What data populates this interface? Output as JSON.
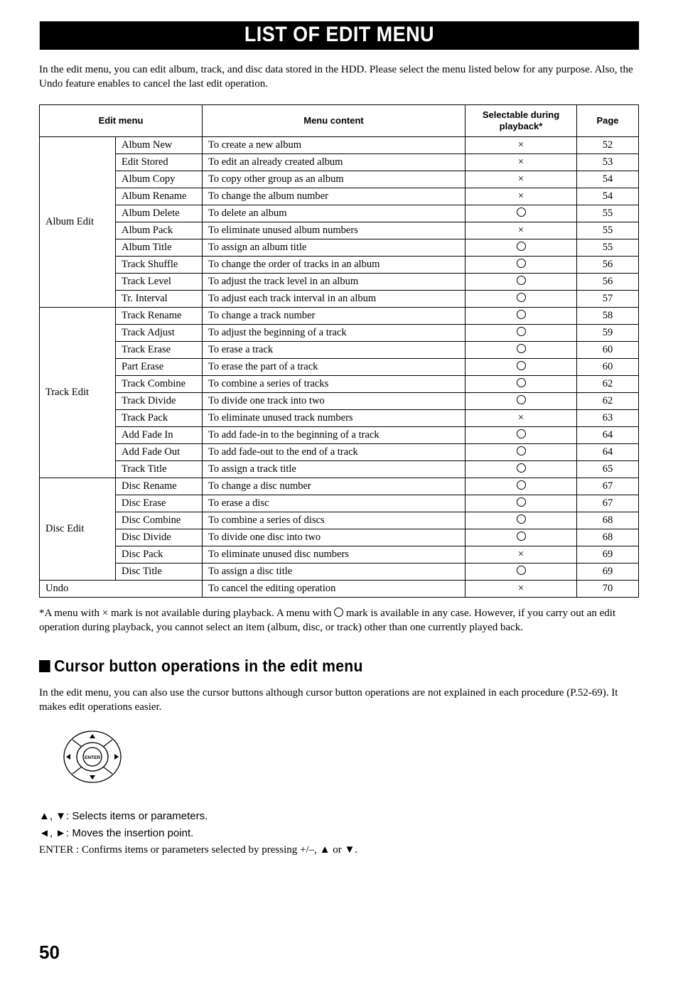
{
  "title": "LIST OF EDIT MENU",
  "intro": "In the edit menu, you can edit album, track, and disc data stored in the HDD. Please select the menu listed below for any purpose. Also, the Undo feature enables to cancel the last edit operation.",
  "headers": {
    "col1": "Edit menu",
    "col2": "Menu content",
    "col3": "Selectable during playback*",
    "col4": "Page"
  },
  "groups": [
    {
      "name": "Album Edit",
      "rows": [
        {
          "item": "Album New",
          "desc": "To create a new album",
          "sel": "×",
          "page": "52"
        },
        {
          "item": "Edit Stored",
          "desc": "To edit an already created album",
          "sel": "×",
          "page": "53"
        },
        {
          "item": "Album Copy",
          "desc": "To copy other group as an album",
          "sel": "×",
          "page": "54"
        },
        {
          "item": "Album Rename",
          "desc": "To change the album number",
          "sel": "×",
          "page": "54"
        },
        {
          "item": "Album Delete",
          "desc": "To delete an album",
          "sel": "○",
          "page": "55"
        },
        {
          "item": "Album Pack",
          "desc": "To eliminate unused album numbers",
          "sel": "×",
          "page": "55"
        },
        {
          "item": "Album Title",
          "desc": "To assign an album title",
          "sel": "○",
          "page": "55"
        },
        {
          "item": "Track Shuffle",
          "desc": "To change the order of tracks in an album",
          "sel": "○",
          "page": "56"
        },
        {
          "item": "Track Level",
          "desc": "To adjust the track level in an album",
          "sel": "○",
          "page": "56"
        },
        {
          "item": "Tr. Interval",
          "desc": "To adjust each track interval in an album",
          "sel": "○",
          "page": "57"
        }
      ]
    },
    {
      "name": "Track Edit",
      "rows": [
        {
          "item": "Track Rename",
          "desc": "To change a track number",
          "sel": "○",
          "page": "58"
        },
        {
          "item": "Track Adjust",
          "desc": "To adjust the beginning of a track",
          "sel": "○",
          "page": "59"
        },
        {
          "item": "Track Erase",
          "desc": "To erase a track",
          "sel": "○",
          "page": "60"
        },
        {
          "item": "Part Erase",
          "desc": "To erase the part of a track",
          "sel": "○",
          "page": "60"
        },
        {
          "item": "Track Combine",
          "desc": "To combine a series of tracks",
          "sel": "○",
          "page": "62"
        },
        {
          "item": "Track Divide",
          "desc": "To divide one track into two",
          "sel": "○",
          "page": "62"
        },
        {
          "item": "Track Pack",
          "desc": "To eliminate unused track numbers",
          "sel": "×",
          "page": "63"
        },
        {
          "item": "Add Fade In",
          "desc": "To add fade-in to the beginning of a track",
          "sel": "○",
          "page": "64"
        },
        {
          "item": "Add Fade Out",
          "desc": "To add fade-out to the end of a track",
          "sel": "○",
          "page": "64"
        },
        {
          "item": "Track Title",
          "desc": "To assign a track title",
          "sel": "○",
          "page": "65"
        }
      ]
    },
    {
      "name": "Disc Edit",
      "rows": [
        {
          "item": "Disc Rename",
          "desc": "To change a disc number",
          "sel": "○",
          "page": "67"
        },
        {
          "item": "Disc Erase",
          "desc": "To erase a disc",
          "sel": "○",
          "page": "67"
        },
        {
          "item": "Disc Combine",
          "desc": "To combine a series of discs",
          "sel": "○",
          "page": "68"
        },
        {
          "item": "Disc Divide",
          "desc": "To divide one disc into two",
          "sel": "○",
          "page": "68"
        },
        {
          "item": "Disc Pack",
          "desc": "To eliminate unused disc numbers",
          "sel": "×",
          "page": "69"
        },
        {
          "item": "Disc Title",
          "desc": "To assign a disc title",
          "sel": "○",
          "page": "69"
        }
      ]
    }
  ],
  "undo": {
    "name": "Undo",
    "desc": "To cancel the editing operation",
    "sel": "×",
    "page": "70"
  },
  "footnote_pre": "*A menu with ",
  "footnote_x": "×",
  "footnote_mid1": " mark is not available during playback. A menu with ",
  "footnote_mid2": " mark is available in any case. However, if you carry out an edit operation during playback, you cannot select an item (album, disc, or track) other than one currently played back.",
  "subhead": "Cursor button operations in the edit menu",
  "subpara": "In the edit menu, you can also use the cursor buttons although cursor button operations are not explained in each procedure (P.52-69). It makes edit operations easier.",
  "bullets": {
    "b1": "▲, ▼: Selects items or parameters.",
    "b2": "◄, ►: Moves the insertion point.",
    "b3": "ENTER : Confirms items or parameters selected by pressing +/–, ▲ or ▼."
  },
  "pagenum": "50"
}
